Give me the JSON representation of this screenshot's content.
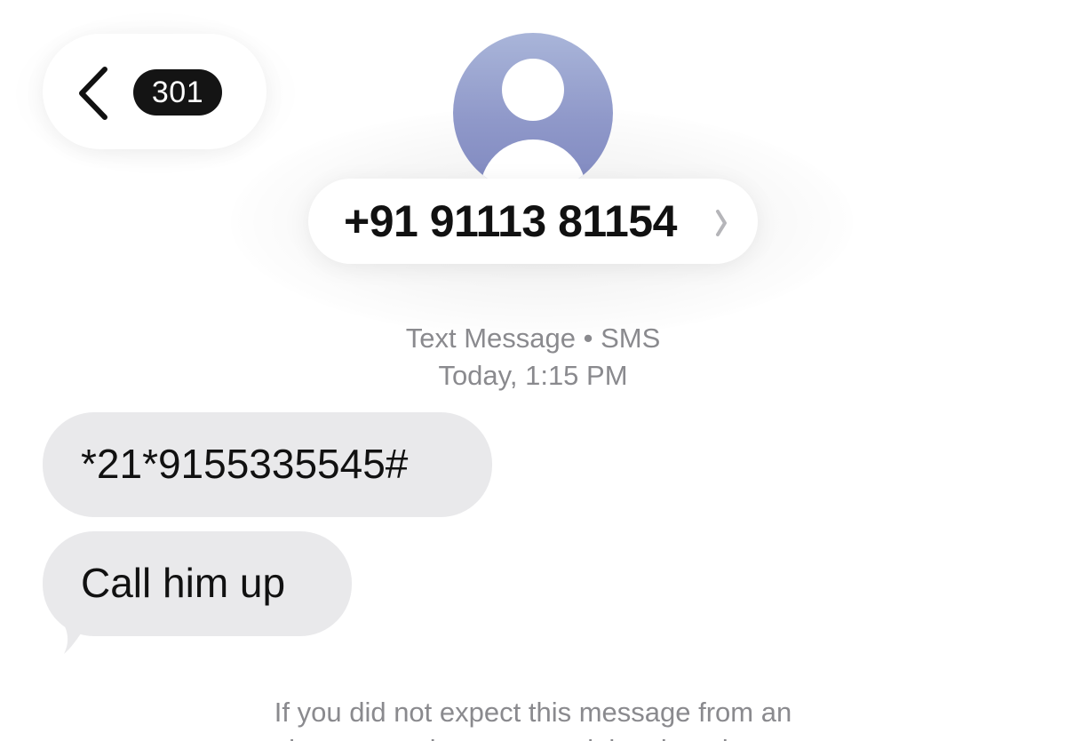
{
  "nav": {
    "unread_count": "301"
  },
  "contact": {
    "phone_number": "+91 91113 81154"
  },
  "conversation": {
    "service_label": "Text Message • SMS",
    "timestamp": "Today, 1:15 PM",
    "messages": [
      {
        "text": "*21*9155335545#"
      },
      {
        "text": "Call him up"
      }
    ],
    "footer_note_line1": "If you did not expect this message from an",
    "footer_note_line2": "unknown sender, you can delete it and report"
  },
  "colors": {
    "bubble_incoming": "#e9e9eb",
    "badge": "#141414",
    "avatar_gradient_top": "#a9b5d9",
    "avatar_gradient_bottom": "#7f88bf",
    "meta_text": "#8a8a8e"
  },
  "icons": {
    "back": "chevron-left-icon",
    "contact_disclosure": "chevron-right-icon",
    "avatar": "person-silhouette-icon"
  }
}
